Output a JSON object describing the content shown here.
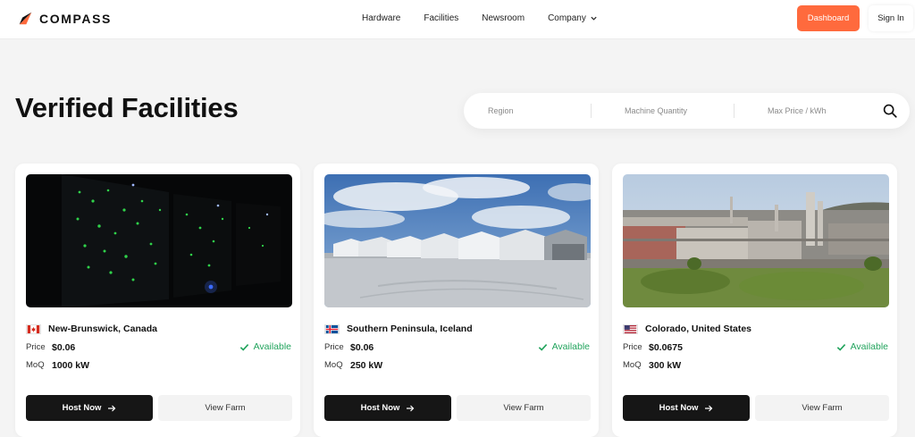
{
  "brand": {
    "name": "COMPASS",
    "accent": "#ff6a3d"
  },
  "nav": {
    "links": [
      "Hardware",
      "Facilities",
      "Newsroom",
      "Company"
    ],
    "dashboard_label": "Dashboard",
    "signin_label": "Sign In"
  },
  "page": {
    "title": "Verified Facilities"
  },
  "search": {
    "region_placeholder": "Region",
    "quantity_placeholder": "Machine Quantity",
    "price_placeholder": "Max Price / kWh",
    "icon": "search-icon"
  },
  "cards": [
    {
      "location": "New-Brunswick, Canada",
      "flag": "canada-flag",
      "price_label": "Price",
      "price": "$0.06",
      "moq_label": "MoQ",
      "moq": "1000 kW",
      "status": "Available",
      "host_label": "Host Now",
      "view_label": "View Farm"
    },
    {
      "location": "Southern Peninsula, Iceland",
      "flag": "iceland-flag",
      "price_label": "Price",
      "price": "$0.06",
      "moq_label": "MoQ",
      "moq": "250 kW",
      "status": "Available",
      "host_label": "Host Now",
      "view_label": "View Farm"
    },
    {
      "location": "Colorado, United States",
      "flag": "usa-flag",
      "price_label": "Price",
      "price": "$0.0675",
      "moq_label": "MoQ",
      "moq": "300 kW",
      "status": "Available",
      "host_label": "Host Now",
      "view_label": "View Farm"
    }
  ],
  "colors": {
    "available": "#22a45d",
    "primary_button": "#161616",
    "secondary_button": "#f3f3f3",
    "background": "#f4f4f4"
  }
}
